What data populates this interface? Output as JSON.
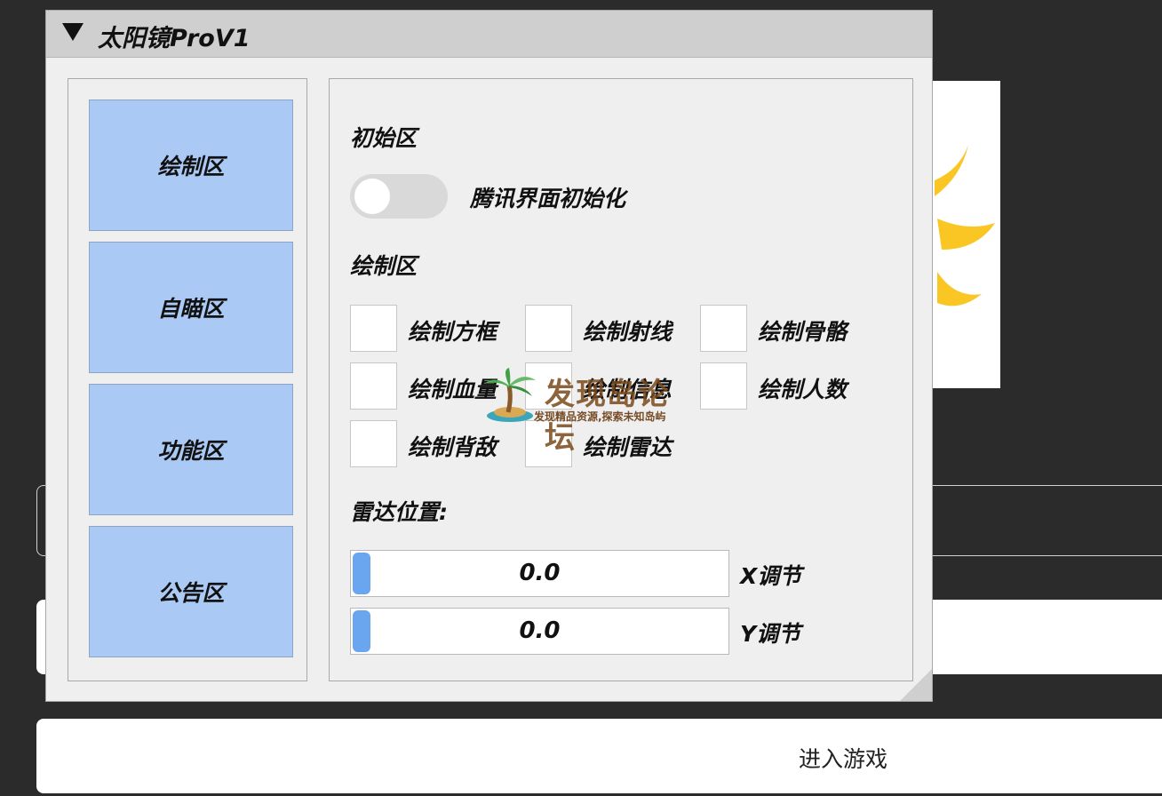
{
  "window": {
    "title": "太阳镜ProV1"
  },
  "nav": {
    "items": [
      {
        "label": "绘制区"
      },
      {
        "label": "自瞄区"
      },
      {
        "label": "功能区"
      },
      {
        "label": "公告区"
      }
    ]
  },
  "init_section": {
    "title": "初始区",
    "toggle_label": "腾讯界面初始化",
    "toggle_on": false
  },
  "draw_section": {
    "title": "绘制区",
    "checkboxes": [
      {
        "label": "绘制方框",
        "checked": false
      },
      {
        "label": "绘制射线",
        "checked": false
      },
      {
        "label": "绘制骨骼",
        "checked": false
      },
      {
        "label": "绘制血量",
        "checked": false
      },
      {
        "label": "绘制信息",
        "checked": false
      },
      {
        "label": "绘制人数",
        "checked": false
      },
      {
        "label": "绘制背敌",
        "checked": false
      },
      {
        "label": "绘制雷达",
        "checked": false
      }
    ]
  },
  "radar_section": {
    "title": "雷达位置:",
    "sliders": [
      {
        "value": "0.0",
        "label": "X调节"
      },
      {
        "value": "0.0",
        "label": "Y调节"
      }
    ]
  },
  "background": {
    "enter_button_label": "进入游戏"
  },
  "watermark": {
    "title": "发现岛论坛",
    "subtitle": "发现精品资源,探索未知岛屿"
  },
  "colors": {
    "nav_button": "#aac9f4",
    "slider_grab": "#6aa6f0",
    "title_bar": "#cfcfcf",
    "logo_accent": "#f9c623"
  }
}
